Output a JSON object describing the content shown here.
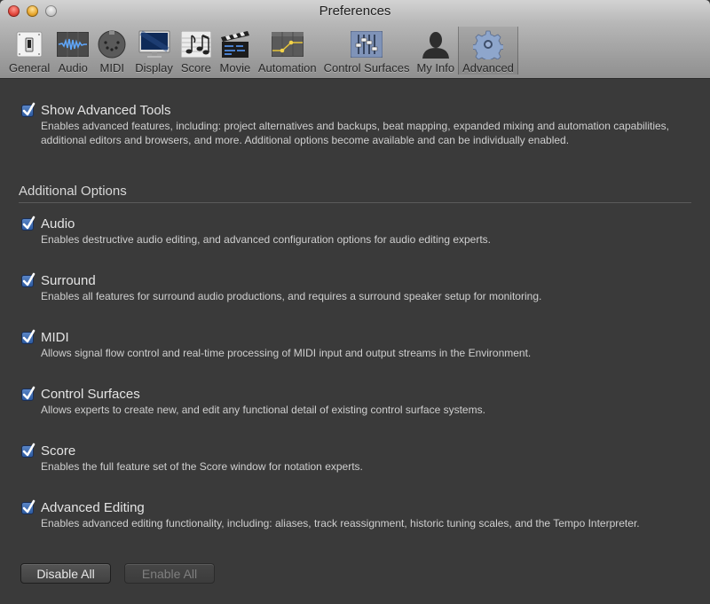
{
  "window": {
    "title": "Preferences"
  },
  "toolbar": {
    "items": [
      {
        "label": "General",
        "icon": "switch-icon"
      },
      {
        "label": "Audio",
        "icon": "waveform-icon"
      },
      {
        "label": "MIDI",
        "icon": "midi-connector-icon"
      },
      {
        "label": "Display",
        "icon": "monitor-icon"
      },
      {
        "label": "Score",
        "icon": "music-notes-icon"
      },
      {
        "label": "Movie",
        "icon": "clapperboard-icon"
      },
      {
        "label": "Automation",
        "icon": "automation-curve-icon"
      },
      {
        "label": "Control Surfaces",
        "icon": "faders-icon"
      },
      {
        "label": "My Info",
        "icon": "person-silhouette-icon"
      },
      {
        "label": "Advanced",
        "icon": "gear-icon"
      }
    ],
    "selected": "Advanced"
  },
  "main": {
    "show_advanced": {
      "label": "Show Advanced Tools",
      "checked": true,
      "description": "Enables advanced features, including: project alternatives and backups, beat mapping, expanded mixing and automation capabilities, additional editors and browsers, and more. Additional options become available and can be individually enabled."
    },
    "section_title": "Additional Options",
    "options": [
      {
        "label": "Audio",
        "checked": true,
        "description": "Enables destructive audio editing, and advanced configuration options for audio editing experts."
      },
      {
        "label": "Surround",
        "checked": true,
        "description": "Enables all features for surround audio productions, and requires a surround speaker setup for monitoring."
      },
      {
        "label": "MIDI",
        "checked": true,
        "description": "Allows signal flow control and real-time processing of MIDI input and output streams in the Environment."
      },
      {
        "label": "Control Surfaces",
        "checked": true,
        "description": "Allows experts to create new, and edit any functional detail of existing control surface systems."
      },
      {
        "label": "Score",
        "checked": true,
        "description": "Enables the full feature set of the Score window for notation experts."
      },
      {
        "label": "Advanced Editing",
        "checked": true,
        "description": "Enables advanced editing functionality, including: aliases, track reassignment, historic tuning scales, and the Tempo Interpreter."
      }
    ],
    "buttons": {
      "disable_all": "Disable All",
      "enable_all": "Enable All"
    }
  },
  "colors": {
    "background": "#3a3a3a",
    "checkbox": "#2c5aa0",
    "text": "#e4e4e4"
  }
}
